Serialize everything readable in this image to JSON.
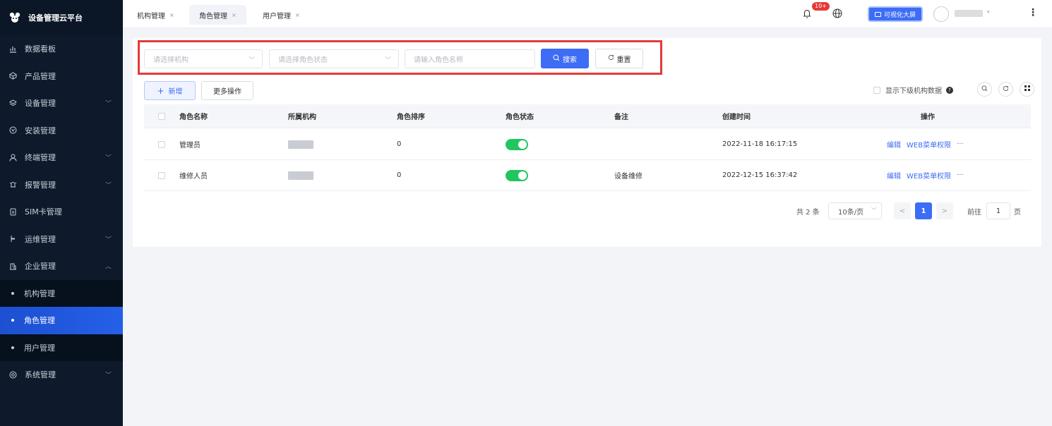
{
  "brand": {
    "title": "设备管理云平台"
  },
  "sidebar": {
    "items": [
      {
        "label": "数据看板",
        "icon": "chart-icon",
        "chevron": false
      },
      {
        "label": "产品管理",
        "icon": "cube-icon",
        "chevron": false
      },
      {
        "label": "设备管理",
        "icon": "layers-icon",
        "chevron": true
      },
      {
        "label": "安装管理",
        "icon": "install-icon",
        "chevron": false
      },
      {
        "label": "终端管理",
        "icon": "user-icon",
        "chevron": true
      },
      {
        "label": "报警管理",
        "icon": "alarm-icon",
        "chevron": true
      },
      {
        "label": "SIM卡管理",
        "icon": "sim-icon",
        "chevron": false
      },
      {
        "label": "运维管理",
        "icon": "maintenance-icon",
        "chevron": true
      },
      {
        "label": "企业管理",
        "icon": "building-icon",
        "chevron": true,
        "expanded": true
      }
    ],
    "submenu": [
      {
        "label": "机构管理",
        "active": false
      },
      {
        "label": "角色管理",
        "active": true
      },
      {
        "label": "用户管理",
        "active": false
      }
    ],
    "last": {
      "label": "系统管理",
      "icon": "settings-icon"
    }
  },
  "tabs": [
    {
      "label": "机构管理",
      "active": false
    },
    {
      "label": "角色管理",
      "active": true
    },
    {
      "label": "用户管理",
      "active": false
    }
  ],
  "topbar": {
    "badge": "10+",
    "visual_screen": "可视化大屏"
  },
  "filters": {
    "org_placeholder": "请选择机构",
    "status_placeholder": "请选择角色状态",
    "name_placeholder": "请输入角色名称",
    "search": "搜索",
    "reset": "重置"
  },
  "actions": {
    "add": "新增",
    "more": "更多操作",
    "show_sub": "显示下级机构数据"
  },
  "table": {
    "headers": [
      "角色名称",
      "所属机构",
      "角色排序",
      "角色状态",
      "备注",
      "创建时间",
      "操作"
    ],
    "rows": [
      {
        "name": "管理员",
        "sort": "0",
        "status": true,
        "remark": "",
        "created": "2022-11-18 16:17:15"
      },
      {
        "name": "维修人员",
        "sort": "0",
        "status": true,
        "remark": "设备维修",
        "created": "2022-12-15 16:37:42"
      }
    ],
    "op_edit": "编辑",
    "op_perm": "WEB菜单权限",
    "op_more": "···"
  },
  "pagination": {
    "total": "共 2 条",
    "page_size": "10条/页",
    "current": "1",
    "goto_label": "前往",
    "goto_value": "1",
    "page_unit": "页"
  },
  "colors": {
    "primary": "#3d6cf5",
    "sidebar": "#0e1a2b",
    "success": "#22c55e",
    "highlight": "#e23b3b"
  }
}
